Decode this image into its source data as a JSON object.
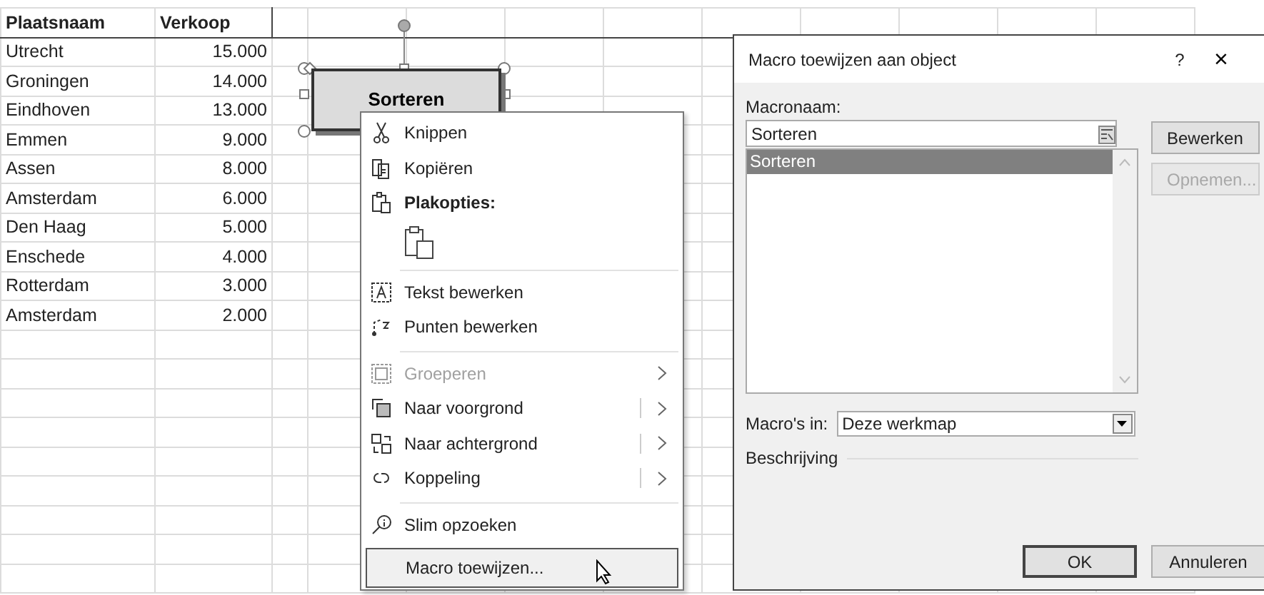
{
  "sheet": {
    "columns": [
      "Plaatsnaam",
      "Verkoop"
    ],
    "rows": [
      [
        "Utrecht",
        "15.000"
      ],
      [
        "Groningen",
        "14.000"
      ],
      [
        "Eindhoven",
        "13.000"
      ],
      [
        "Emmen",
        "9.000"
      ],
      [
        "Assen",
        "8.000"
      ],
      [
        "Amsterdam",
        "6.000"
      ],
      [
        "Den Haag",
        "5.000"
      ],
      [
        "Enschede",
        "4.000"
      ],
      [
        "Rotterdam",
        "3.000"
      ],
      [
        "Amsterdam",
        "2.000"
      ]
    ]
  },
  "shape": {
    "label": "Sorteren",
    "selected": true
  },
  "context_menu": {
    "items": [
      {
        "kind": "command",
        "label": "Knippen",
        "disabled": false,
        "submenu": false,
        "selected": false
      },
      {
        "kind": "command",
        "label": "Kopiëren",
        "disabled": false,
        "submenu": false,
        "selected": false
      },
      {
        "kind": "heading",
        "label": "Plakopties:"
      },
      {
        "kind": "paste_option"
      },
      {
        "kind": "separator"
      },
      {
        "kind": "command",
        "label": "Tekst bewerken",
        "disabled": false,
        "submenu": false,
        "selected": false
      },
      {
        "kind": "command",
        "label": "Punten bewerken",
        "disabled": false,
        "submenu": false,
        "selected": false
      },
      {
        "kind": "separator"
      },
      {
        "kind": "command",
        "label": "Groeperen",
        "disabled": true,
        "submenu": true,
        "selected": false
      },
      {
        "kind": "command",
        "label": "Naar voorgrond",
        "disabled": false,
        "submenu": true,
        "selected": false
      },
      {
        "kind": "command",
        "label": "Naar achtergrond",
        "disabled": false,
        "submenu": true,
        "selected": false
      },
      {
        "kind": "command",
        "label": "Koppeling",
        "disabled": false,
        "submenu": true,
        "selected": false
      },
      {
        "kind": "separator"
      },
      {
        "kind": "command",
        "label": "Slim opzoeken",
        "disabled": false,
        "submenu": false,
        "selected": false
      },
      {
        "kind": "command",
        "label": "Macro toewijzen...",
        "disabled": false,
        "submenu": false,
        "selected": true
      }
    ]
  },
  "dialog": {
    "title": "Macro toewijzen aan object",
    "help": "?",
    "close": "×",
    "macro_name_label": "Macronaam:",
    "macro_name_value": "Sorteren",
    "macro_list": [
      {
        "label": "Sorteren",
        "selected": true
      }
    ],
    "side_buttons": [
      {
        "label": "Bewerken",
        "disabled": false
      },
      {
        "label": "Opnemen...",
        "disabled": true
      }
    ],
    "macros_in_label": "Macro's in:",
    "macros_in_value": "Deze werkmap",
    "description_label": "Beschrijving",
    "footer_buttons": [
      {
        "label": "OK",
        "default": true
      },
      {
        "label": "Annuleren",
        "default": false
      }
    ]
  }
}
